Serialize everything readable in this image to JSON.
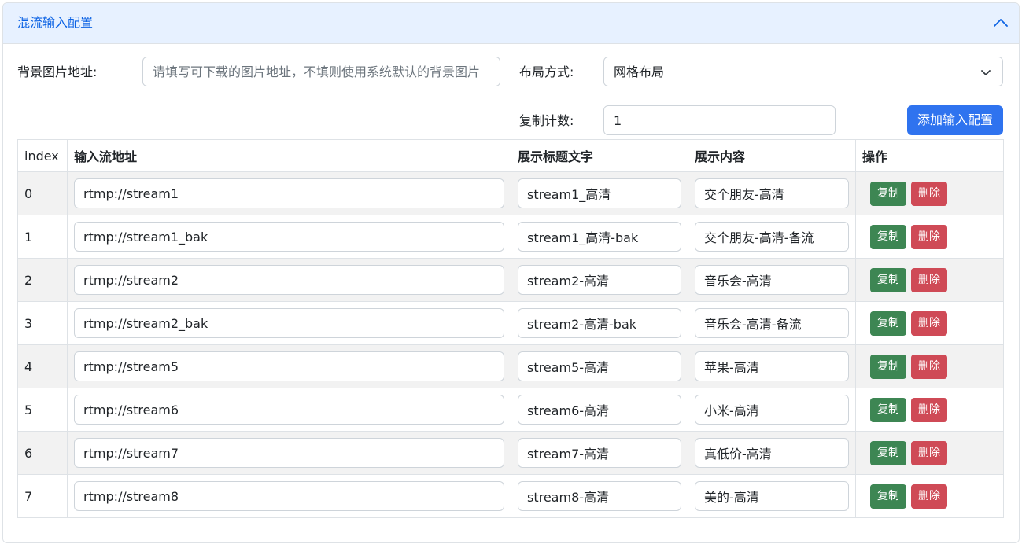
{
  "header": {
    "title": "混流输入配置"
  },
  "form": {
    "bg_label": "背景图片地址:",
    "bg_placeholder": "请填写可下载的图片地址，不填则使用系统默认的背景图片",
    "layout_label": "布局方式:",
    "layout_value": "网格布局",
    "copy_count_label": "复制计数:",
    "copy_count_value": "1",
    "add_button": "添加输入配置"
  },
  "table": {
    "headers": [
      "index",
      "输入流地址",
      "展示标题文字",
      "展示内容",
      "操作"
    ],
    "copy_label": "复制",
    "delete_label": "删除",
    "rows": [
      {
        "index": "0",
        "url": "rtmp://stream1",
        "title": "stream1_高清",
        "content": "交个朋友-高清"
      },
      {
        "index": "1",
        "url": "rtmp://stream1_bak",
        "title": "stream1_高清-bak",
        "content": "交个朋友-高清-备流"
      },
      {
        "index": "2",
        "url": "rtmp://stream2",
        "title": "stream2-高清",
        "content": "音乐会-高清"
      },
      {
        "index": "3",
        "url": "rtmp://stream2_bak",
        "title": "stream2-高清-bak",
        "content": "音乐会-高清-备流"
      },
      {
        "index": "4",
        "url": "rtmp://stream5",
        "title": "stream5-高清",
        "content": "苹果-高清"
      },
      {
        "index": "5",
        "url": "rtmp://stream6",
        "title": "stream6-高清",
        "content": "小米-高清"
      },
      {
        "index": "6",
        "url": "rtmp://stream7",
        "title": "stream7-高清",
        "content": "真低价-高清"
      },
      {
        "index": "7",
        "url": "rtmp://stream8",
        "title": "stream8-高清",
        "content": "美的-高清"
      }
    ]
  },
  "colors": {
    "header_bg": "#e7f1ff",
    "header_text": "#0c63e4",
    "primary_button": "#2f73ef",
    "copy_button": "#3d8653",
    "delete_button": "#cf4a56",
    "striped_row": "#f2f2f2"
  },
  "icons": {
    "collapse": "chevron-up-icon",
    "select": "chevron-down-icon"
  }
}
